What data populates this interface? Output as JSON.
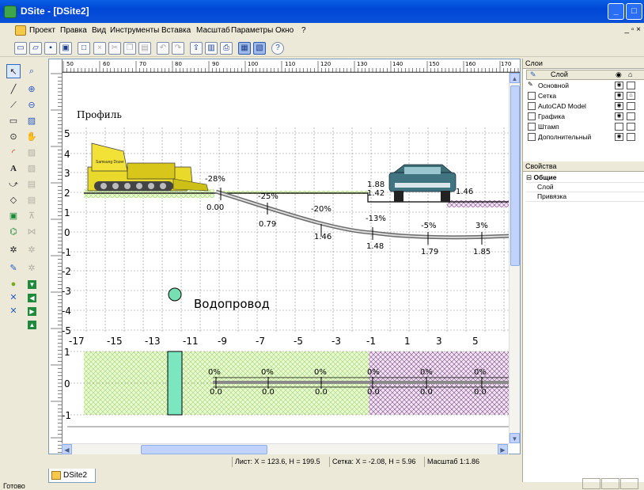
{
  "window": {
    "title": "DSite - [DSite2]",
    "min": "_",
    "max": "□",
    "close": "X",
    "mdi_controls": "_ ▫ ×"
  },
  "menu": [
    "Проект",
    "Правка",
    "Вид",
    "Инструменты",
    "Вставка",
    "Масштаб",
    "Параметры",
    "Окно",
    "?"
  ],
  "toolbar_icons": [
    "new-file-icon",
    "open-folder-icon",
    "save-icon",
    "print-preview-icon",
    "window-icon",
    "delete-icon",
    "cut-icon",
    "copy-icon",
    "paste-icon",
    "undo-icon",
    "redo-icon",
    "export-icon",
    "chart-icon",
    "printer-icon",
    "layers-icon",
    "props-icon",
    "help-icon"
  ],
  "ruler": {
    "top_labels": [
      "50",
      "60",
      "70",
      "80",
      "90",
      "100",
      "110",
      "120",
      "130",
      "140",
      "150",
      "160",
      "170"
    ]
  },
  "drawing": {
    "profile_label": "Профиль",
    "y_labels": [
      "5",
      "4",
      "3",
      "2",
      "1",
      "0",
      "-1",
      "-2",
      "-3",
      "-4",
      "-5"
    ],
    "x_labels": [
      "-17",
      "-15",
      "-13",
      "-11",
      "-9",
      "-7",
      "-5",
      "-3",
      "-1",
      "1",
      "3",
      "5"
    ],
    "slopes": [
      "-28%",
      "-25%",
      "-20%",
      "-13%",
      "-5%",
      "3%"
    ],
    "elevations": [
      "0.00",
      "0.79",
      "1.46",
      "1.48",
      "1.79",
      "1.85"
    ],
    "car_labels": [
      "1.88",
      "1.42",
      "1.46"
    ],
    "pipe_label": "Водопровод",
    "lower_y_labels": [
      "1",
      "0",
      "-1"
    ],
    "lower_pct": [
      "0%",
      "0%",
      "0%",
      "0%",
      "0%",
      "0%"
    ],
    "lower_vals": [
      "0.0",
      "0.0",
      "0.0",
      "0.0",
      "0.0",
      "0.0"
    ],
    "dozer_text": "Samsung Dozer"
  },
  "status": {
    "sheet": "Лист: X = 123.6, H = 199.5",
    "grid": "Сетка: X = -2.08, H = 5.96",
    "scale": "Масштаб 1:1.86"
  },
  "doc_tab": "DSite2",
  "ready": "Готово",
  "layers_panel": {
    "title": "Слои",
    "header": "Слой",
    "rows": [
      {
        "name": "Основной",
        "visible": true,
        "locked": false,
        "active": true
      },
      {
        "name": "Сетка",
        "visible": true,
        "locked": true,
        "active": false
      },
      {
        "name": "AutoCAD Model",
        "visible": true,
        "locked": false,
        "active": false
      },
      {
        "name": "Графика",
        "visible": true,
        "locked": false,
        "active": false
      },
      {
        "name": "Штамп",
        "visible": false,
        "locked": false,
        "active": false
      },
      {
        "name": "Дополнительный",
        "visible": true,
        "locked": false,
        "active": false
      }
    ]
  },
  "props_panel": {
    "title": "Свойства",
    "group": "Общие",
    "rows": [
      "Слой",
      "Привязка"
    ]
  }
}
